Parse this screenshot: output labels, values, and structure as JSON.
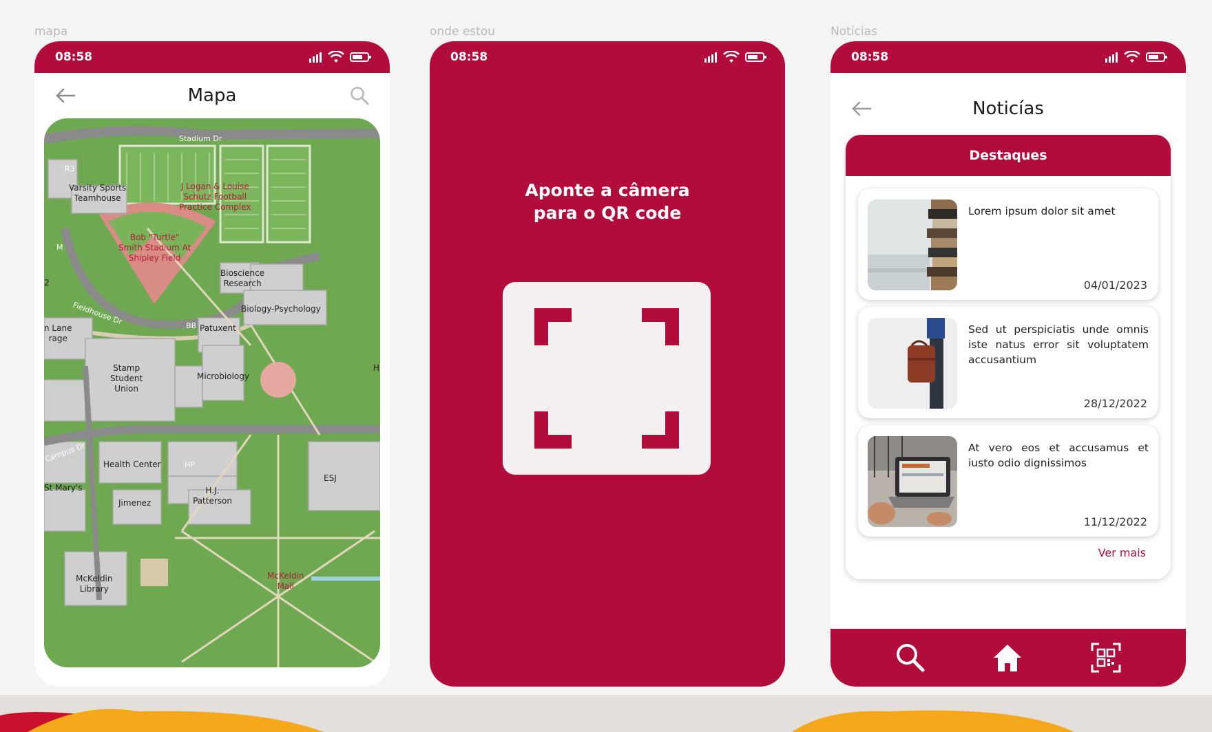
{
  "colors": {
    "brand": "#b20c3c",
    "background": "#f4f4f4",
    "map_grass": "#5e9e45"
  },
  "frames": [
    {
      "label": "mapa"
    },
    {
      "label": "onde estou"
    },
    {
      "label": "Notícias"
    }
  ],
  "status_bar": {
    "time": "08:58",
    "icons": [
      "signal-icon",
      "wifi-icon",
      "battery-icon"
    ]
  },
  "map_screen": {
    "title": "Mapa",
    "back_icon": "arrow-left-icon",
    "search_icon": "search-icon",
    "map_labels": {
      "stadium_dr": "Stadium Dr",
      "r3": "R3",
      "varsity": "Varsity Sports\nTeamhouse",
      "logan": "J Logan & Louise\nSchutz Football\nPractice Complex",
      "bob_turtle": "Bob \"Turtle\"\nSmith Stadium At\nShipley Field",
      "bioscience": "Bioscience\nResearch",
      "biology": "Biology-Psychology",
      "fieldhouse": "Fieldhouse Dr",
      "bb": "BB",
      "patuxent": "Patuxent",
      "lane": "n Lane\nrage",
      "stamp": "Stamp\nStudent\nUnion",
      "microbiology": "Microbiology",
      "campus_dr": "Campus Dr",
      "health": "Health Center",
      "hp": "HP",
      "esj": "ESJ",
      "st_marys": "St Mary's",
      "hj": "H.J.\nPatterson",
      "jimenez": "Jimenez",
      "mckeldin_library": "McKeldin\nLibrary",
      "mckeldin_mall": "McKeldin\nMall",
      "m": "M",
      "edge2": "2",
      "h": "H"
    }
  },
  "qr_screen": {
    "instruction_line1": "Aponte a câmera",
    "instruction_line2": "para o QR code",
    "scanner_icon": "qr-scan-frame-icon"
  },
  "news_screen": {
    "title": "Noticías",
    "back_icon": "arrow-left-icon",
    "section_title": "Destaques",
    "items": [
      {
        "text": "Lorem ipsum dolor sit amet",
        "date": "04/01/2023",
        "thumb": "books-photo"
      },
      {
        "text": "Sed ut perspiciatis unde omnis iste natus error sit voluptatem accusantium",
        "date": "28/12/2022",
        "thumb": "briefcase-photo"
      },
      {
        "text": "At vero eos et accusamus et iusto odio dignissimos",
        "date": "11/12/2022",
        "thumb": "laptop-photo"
      }
    ],
    "see_more": "Ver mais",
    "bottom_nav": {
      "search": "search-icon",
      "home": "home-icon",
      "qr": "qr-code-icon"
    }
  }
}
